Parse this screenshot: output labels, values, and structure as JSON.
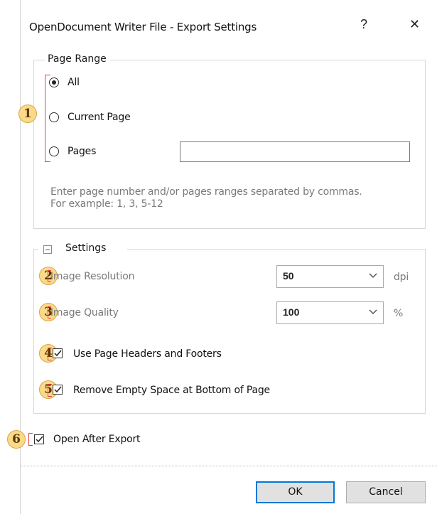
{
  "window": {
    "title": "OpenDocument Writer File - Export Settings",
    "help_label": "?",
    "close_label": "✕"
  },
  "page_range": {
    "legend": "Page Range",
    "options": [
      {
        "label": "All",
        "selected": true
      },
      {
        "label": "Current Page",
        "selected": false
      },
      {
        "label": "Pages",
        "selected": false
      }
    ],
    "pages_input_value": "",
    "hint_line1": "Enter page number and/or pages ranges separated by commas.",
    "hint_line2": "For example: 1, 3, 5-12"
  },
  "settings": {
    "legend": "Settings",
    "collapse_symbol": "−",
    "image_resolution": {
      "label": "Image Resolution",
      "value": "50",
      "unit": "dpi"
    },
    "image_quality": {
      "label": "Image Quality",
      "value": "100",
      "unit": "%"
    },
    "use_headers_footers": {
      "label": "Use Page Headers and Footers",
      "checked": true
    },
    "remove_empty_space": {
      "label": "Remove Empty Space at Bottom of Page",
      "checked": true
    }
  },
  "open_after_export": {
    "label": "Open After Export",
    "checked": true
  },
  "buttons": {
    "ok": "OK",
    "cancel": "Cancel"
  },
  "callouts": [
    "1",
    "2",
    "3",
    "4",
    "5",
    "6"
  ],
  "colors": {
    "callout_fill": "#fbd98a",
    "callout_bracket": "#e04141",
    "ok_border": "#0078d7"
  }
}
